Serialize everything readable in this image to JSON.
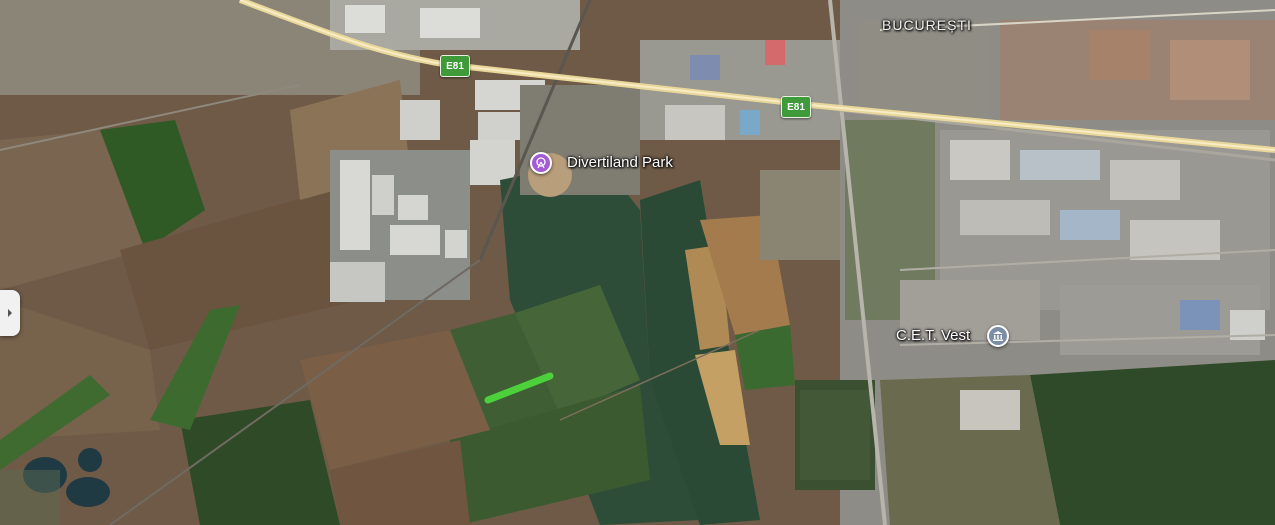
{
  "map": {
    "city_label": "BUCUREȘTI",
    "road_shields": [
      "E81",
      "E81"
    ],
    "pois": [
      {
        "name": "Divertiland Park",
        "icon": "amusement-park-icon",
        "color": "#a45bd6"
      },
      {
        "name": "C.E.T. Vest",
        "icon": "building-icon",
        "color": "#7b8ea6"
      }
    ],
    "route_highlight_color": "#4cd13b",
    "highway_color": "#f1e2a6"
  },
  "controls": {
    "side_panel_toggle_icon": "chevron-right-icon"
  }
}
